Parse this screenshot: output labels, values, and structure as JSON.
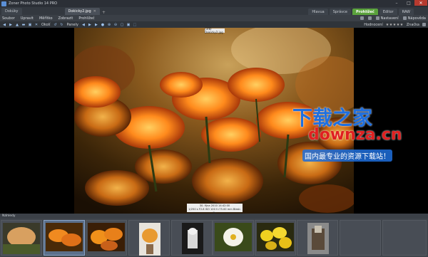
{
  "window": {
    "title": "Zoner Photo Studio 14 PRO"
  },
  "tabs": [
    {
      "label": "Dokúky"
    },
    {
      "label": "Dokicky2.jpg",
      "active": true
    }
  ],
  "modes": [
    {
      "label": "Hlavua"
    },
    {
      "label": "Správce"
    },
    {
      "label": "Prohlížeč",
      "active": true
    },
    {
      "label": "Editor"
    },
    {
      "label": "RAW"
    }
  ],
  "menu": {
    "items": [
      "Soubor",
      "Upravit",
      "Měřítko",
      "Zobrazit",
      "Prohlížeč"
    ],
    "right": [
      "Nastavení",
      "Nápověda"
    ]
  },
  "toolbar": {
    "okoli_label": "Okolí",
    "panely_label": "Panely",
    "hodnoceni_label": "Hodnocení",
    "hodnoceni_stars": "★★★★★",
    "znacka_label": "Značka"
  },
  "viewer": {
    "file_label": "(3/8) Dokicky2.jpg",
    "info_line1": "30. října 2010 14:42:00",
    "info_line2": "1/250 s F2.8 ISO 100 f=75.00 mm Blesk: Ne"
  },
  "watermark": {
    "title": "下载之家",
    "domain": "downza.cn",
    "slogan": "国内最专业的资源下载站！"
  },
  "filmstrip": {
    "label": "Náhledy"
  },
  "colors": {
    "accent": "#5aa23c",
    "titlebar": "#2b2f36",
    "filmstrip": "#40454c"
  }
}
